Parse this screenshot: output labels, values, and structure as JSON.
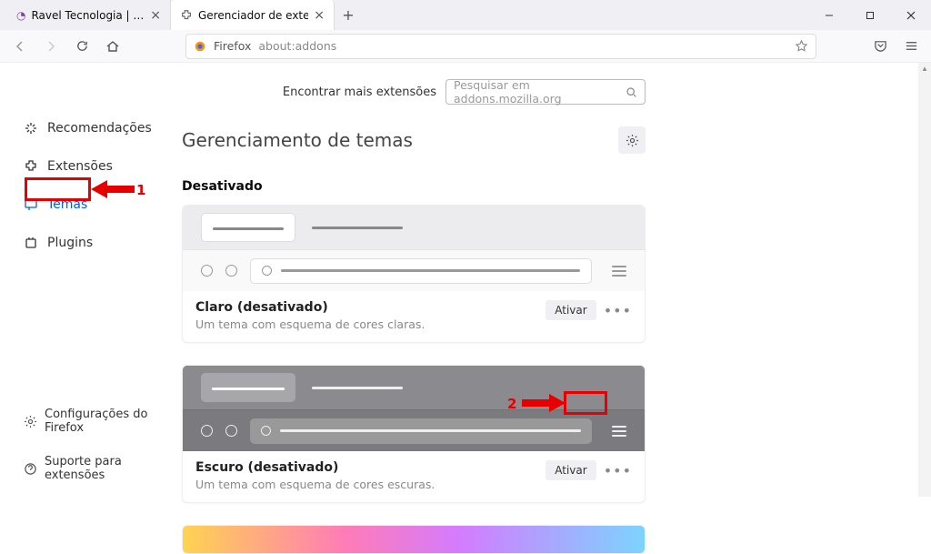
{
  "tabs": [
    {
      "title": "Ravel Tecnologia | Sua empresa"
    },
    {
      "title": "Gerenciador de extensões"
    }
  ],
  "urlbar": {
    "identity": "Firefox",
    "url": "about:addons"
  },
  "sidebar": {
    "items": [
      {
        "label": "Recomendações"
      },
      {
        "label": "Extensões"
      },
      {
        "label": "Temas"
      },
      {
        "label": "Plugins"
      }
    ],
    "bottom": [
      {
        "label": "Configurações do Firefox"
      },
      {
        "label": "Suporte para extensões"
      }
    ]
  },
  "findbar": {
    "label": "Encontrar mais extensões",
    "placeholder": "Pesquisar em addons.mozilla.org"
  },
  "heading": "Gerenciamento de temas",
  "section_disabled": "Desativado",
  "themes": [
    {
      "title": "Claro (desativado)",
      "desc": "Um tema com esquema de cores claras.",
      "action": "Ativar"
    },
    {
      "title": "Escuro (desativado)",
      "desc": "Um tema com esquema de cores escuras.",
      "action": "Ativar"
    }
  ],
  "annotations": {
    "one": "1",
    "two": "2"
  }
}
